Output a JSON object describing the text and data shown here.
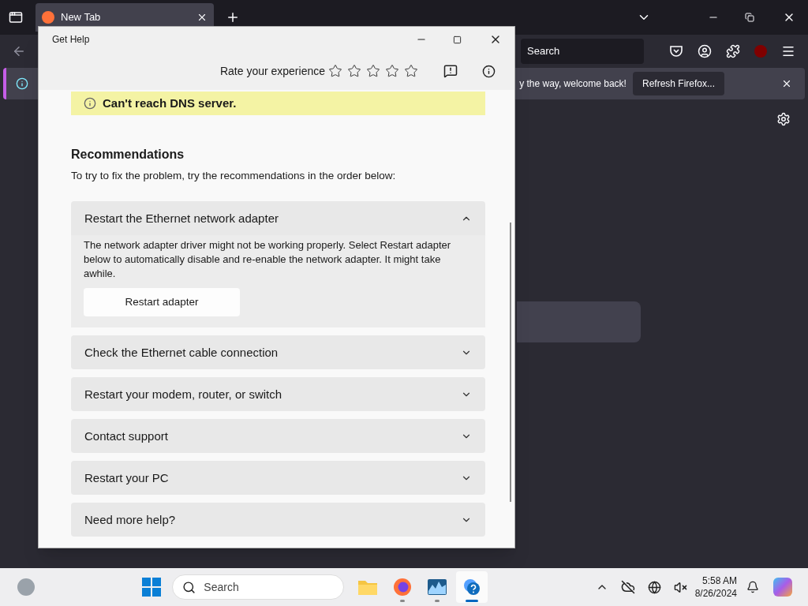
{
  "browser": {
    "tab": {
      "title": "New Tab"
    },
    "search": {
      "placeholder": "Search"
    },
    "notification": {
      "text": "y the way, welcome back!",
      "button": "Refresh Firefox..."
    }
  },
  "dialog": {
    "title": "Get Help",
    "rating": {
      "label": "Rate your experience",
      "stars": 0
    },
    "banner": {
      "text": "Can't reach DNS server."
    },
    "recommendations": {
      "heading": "Recommendations",
      "intro": "To try to fix the problem, try the recommendations in the order below:",
      "items": [
        {
          "title": "Restart the Ethernet network adapter",
          "expanded": true,
          "body": "The network adapter driver might not be working properly. Select Restart adapter below to automatically disable and re-enable the network adapter. It might take awhile.",
          "button": "Restart adapter"
        },
        {
          "title": "Check the Ethernet cable connection",
          "expanded": false
        },
        {
          "title": "Restart your modem, router, or switch",
          "expanded": false
        },
        {
          "title": "Contact support",
          "expanded": false
        },
        {
          "title": "Restart your PC",
          "expanded": false
        },
        {
          "title": "Need more help?",
          "expanded": false
        }
      ]
    }
  },
  "taskbar": {
    "search": {
      "placeholder": "Search"
    },
    "apps": [
      {
        "kind": "files",
        "running": false,
        "selected": false
      },
      {
        "kind": "firefox",
        "running": true,
        "selected": false
      },
      {
        "kind": "monitor",
        "running": true,
        "selected": false
      },
      {
        "kind": "help",
        "running": true,
        "selected": true
      }
    ],
    "clock": {
      "time": "5:58 AM",
      "date": "8/26/2024"
    }
  }
}
